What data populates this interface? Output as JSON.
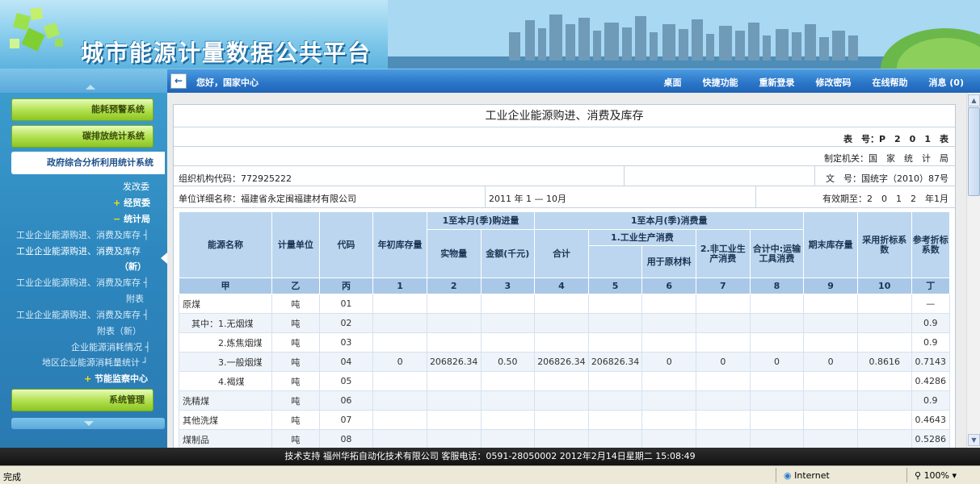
{
  "banner": {
    "title": "城市能源计量数据公共平台"
  },
  "navbar": {
    "greeting": "您好，国家中心",
    "links": [
      "桌面",
      "快捷功能",
      "重新登录",
      "修改密码",
      "在线帮助",
      "消息 (0)"
    ]
  },
  "sidebar": {
    "btn_energy_warning": "能耗预警系统",
    "btn_carbon": "碳排放统计系统",
    "btn_gov": "政府综合分析利用统计系统",
    "item_fagaiwei": "发改委",
    "item_jingmaowei": "经贸委",
    "item_tongjiju": "统计局",
    "item_r1": "工业企业能源购进、消费及库存",
    "item_r2a": "工业企业能源购进、消费及库存",
    "item_r2b": "（新）",
    "item_r3a": "工业企业能源购进、消费及库存",
    "item_r3b": "附表",
    "item_r4a": "工业企业能源购进、消费及库存",
    "item_r4b": "附表（新）",
    "item_r5": "企业能源消耗情况",
    "item_r6": "地区企业能源消耗量统计",
    "item_jieneng": "节能监察中心",
    "btn_sys": "系统管理"
  },
  "report": {
    "title": "工业企业能源购进、消费及库存",
    "form_no": "表　号：P　2　0　1　表",
    "authority": "制定机关：国　家　统　计　局",
    "org_code": "组织机构代码：772925222",
    "doc_no": "文　号：国统字（2010）87号",
    "unit_name": "单位详细名称：福建省永定闽福建材有限公司",
    "period": "2011 年 1 — 10月",
    "valid_until": "有效期至：2　0　1　2　年1月"
  },
  "table": {
    "h_name": "能源名称",
    "h_unit": "计量单位",
    "h_code": "代码",
    "h_begin_stock": "年初库存量",
    "h_purchase": "1至本月(季)购进量",
    "h_phys": "实物量",
    "h_amount": "金额(千元)",
    "h_consume": "1至本月(季)消费量",
    "h_total": "合计",
    "h_ind": "1.工业生产消费",
    "h_raw": "用于原材料",
    "h_nonind": "2.非工业生产消费",
    "h_transport": "合计中:运输工具消费",
    "h_end_stock": "期末库存量",
    "h_factor": "采用折标系数",
    "h_ref_factor": "参考折标系数",
    "idx": [
      "甲",
      "乙",
      "丙",
      "1",
      "2",
      "3",
      "4",
      "5",
      "6",
      "7",
      "8",
      "9",
      "10",
      "丁"
    ],
    "rows": [
      [
        "原煤",
        "吨",
        "01",
        "",
        "",
        "",
        "",
        "",
        "",
        "",
        "",
        "",
        "",
        "—"
      ],
      [
        "　其中：1.无烟煤",
        "吨",
        "02",
        "",
        "",
        "",
        "",
        "",
        "",
        "",
        "",
        "",
        "",
        "0.9"
      ],
      [
        "　　　　2.炼焦烟煤",
        "吨",
        "03",
        "",
        "",
        "",
        "",
        "",
        "",
        "",
        "",
        "",
        "",
        "0.9"
      ],
      [
        "　　　　3.一般烟煤",
        "吨",
        "04",
        "0",
        "206826.34",
        "0.50",
        "206826.34",
        "206826.34",
        "0",
        "0",
        "0",
        "0",
        "0.8616",
        "0.7143"
      ],
      [
        "　　　　4.褐煤",
        "吨",
        "05",
        "",
        "",
        "",
        "",
        "",
        "",
        "",
        "",
        "",
        "",
        "0.4286"
      ],
      [
        "洗精煤",
        "吨",
        "06",
        "",
        "",
        "",
        "",
        "",
        "",
        "",
        "",
        "",
        "",
        "0.9"
      ],
      [
        "其他洗煤",
        "吨",
        "07",
        "",
        "",
        "",
        "",
        "",
        "",
        "",
        "",
        "",
        "",
        "0.4643"
      ],
      [
        "煤制品",
        "吨",
        "08",
        "",
        "",
        "",
        "",
        "",
        "",
        "",
        "",
        "",
        "",
        "0.5286"
      ]
    ]
  },
  "footer": {
    "text": "技术支持 福州华拓自动化技术有限公司 客服电话：0591-28050002 2012年2月14日星期二 15:08:49"
  },
  "statusbar": {
    "done": "完成",
    "zone": "Internet",
    "zoom": "100%"
  }
}
